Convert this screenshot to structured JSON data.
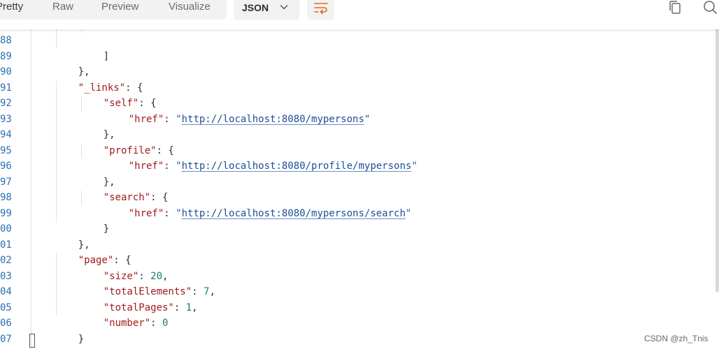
{
  "toolbar": {
    "tabs": [
      {
        "label": "Pretty",
        "active": true
      },
      {
        "label": "Raw",
        "active": false
      },
      {
        "label": "Preview",
        "active": false
      },
      {
        "label": "Visualize",
        "active": false
      }
    ],
    "format": {
      "selected": "JSON",
      "icon": "chevron-down-icon"
    },
    "wrap_icon": "wrap-lines-icon",
    "copy_icon": "copy-icon",
    "search_icon": "search-icon"
  },
  "editor": {
    "line_numbers": [
      "88",
      "89",
      "90",
      "91",
      "92",
      "93",
      "94",
      "95",
      "96",
      "97",
      "98",
      "99",
      "00",
      "01",
      "02",
      "03",
      "04",
      "05",
      "06",
      "07"
    ],
    "lines": [
      {
        "key": null,
        "text": "]"
      },
      {
        "text": "},"
      },
      {
        "key": "\"_links\"",
        "rest": ": {"
      },
      {
        "key": "\"self\"",
        "rest": ": {"
      },
      {
        "key": "\"href\"",
        "url": "http://localhost:8080/mypersons"
      },
      {
        "text": "},"
      },
      {
        "key": "\"profile\"",
        "rest": ": {"
      },
      {
        "key": "\"href\"",
        "url": "http://localhost:8080/profile/mypersons"
      },
      {
        "text": "},"
      },
      {
        "key": "\"search\"",
        "rest": ": {"
      },
      {
        "key": "\"href\"",
        "url": "http://localhost:8080/mypersons/search"
      },
      {
        "text": "}"
      },
      {
        "text": "},"
      },
      {
        "key": "\"page\"",
        "rest": ": {"
      },
      {
        "key": "\"size\"",
        "num": "20",
        "after": ","
      },
      {
        "key": "\"totalElements\"",
        "num": "7",
        "after": ","
      },
      {
        "key": "\"totalPages\"",
        "num": "1",
        "after": ","
      },
      {
        "key": "\"number\"",
        "num": "0",
        "after": ""
      },
      {
        "text": "}"
      },
      {
        "text": "}"
      }
    ]
  },
  "colors": {
    "key": "#a11b1b",
    "string": "#2a5aa3",
    "number": "#1a7a6e",
    "line_number": "#2b6fb5"
  },
  "watermark": "CSDN @zh_Tnis"
}
